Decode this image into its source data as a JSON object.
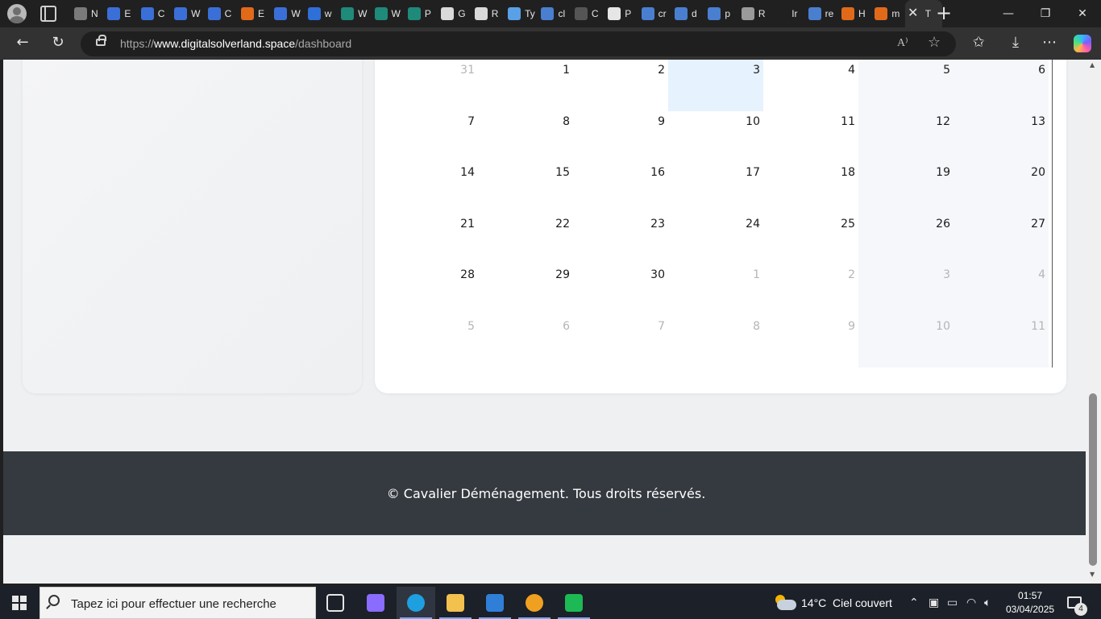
{
  "browser": {
    "tabs": [
      {
        "title": "N",
        "icon": "globe-icon"
      },
      {
        "title": "E",
        "icon": "slash-icon"
      },
      {
        "title": "C",
        "icon": "slash-icon"
      },
      {
        "title": "W",
        "icon": "slash-icon"
      },
      {
        "title": "C",
        "icon": "slash-icon"
      },
      {
        "title": "E",
        "icon": "orange-grid-icon"
      },
      {
        "title": "W",
        "icon": "slash-icon"
      },
      {
        "title": "w",
        "icon": "bing-icon"
      },
      {
        "title": "W",
        "icon": "teal-book-icon"
      },
      {
        "title": "W",
        "icon": "teal-book-icon"
      },
      {
        "title": "P",
        "icon": "teal-book-icon"
      },
      {
        "title": "G",
        "icon": "github-icon"
      },
      {
        "title": "R",
        "icon": "github-icon"
      },
      {
        "title": "Ty",
        "icon": "terminal-icon"
      },
      {
        "title": "cl",
        "icon": "search-icon"
      },
      {
        "title": "C",
        "icon": "dark-circle-icon"
      },
      {
        "title": "P",
        "icon": "openai-icon"
      },
      {
        "title": "cr",
        "icon": "search-icon"
      },
      {
        "title": "d",
        "icon": "search-icon"
      },
      {
        "title": "p",
        "icon": "search-icon"
      },
      {
        "title": "R",
        "icon": "image-icon"
      },
      {
        "title": "Ir",
        "icon": "blank-icon"
      },
      {
        "title": "re",
        "icon": "search-icon"
      },
      {
        "title": "H",
        "icon": "orange-grid-icon"
      },
      {
        "title": "m",
        "icon": "orange-grid-icon"
      },
      {
        "title": "T",
        "icon": "blank-icon",
        "active": true
      }
    ],
    "url_prefix": "https://",
    "url_host": "www.digitalsolverland.space",
    "url_path": "/dashboard",
    "read_aloud": "A⁾"
  },
  "calendar": {
    "days": [
      {
        "n": "31",
        "other": true
      },
      {
        "n": "1"
      },
      {
        "n": "2"
      },
      {
        "n": "3",
        "today": true
      },
      {
        "n": "4"
      },
      {
        "n": "5",
        "weekend": true
      },
      {
        "n": "6",
        "weekend": true
      },
      {
        "n": "7"
      },
      {
        "n": "8"
      },
      {
        "n": "9"
      },
      {
        "n": "10"
      },
      {
        "n": "11"
      },
      {
        "n": "12",
        "weekend": true
      },
      {
        "n": "13",
        "weekend": true
      },
      {
        "n": "14"
      },
      {
        "n": "15"
      },
      {
        "n": "16"
      },
      {
        "n": "17"
      },
      {
        "n": "18"
      },
      {
        "n": "19",
        "weekend": true
      },
      {
        "n": "20",
        "weekend": true
      },
      {
        "n": "21"
      },
      {
        "n": "22"
      },
      {
        "n": "23"
      },
      {
        "n": "24"
      },
      {
        "n": "25"
      },
      {
        "n": "26",
        "weekend": true
      },
      {
        "n": "27",
        "weekend": true
      },
      {
        "n": "28"
      },
      {
        "n": "29"
      },
      {
        "n": "30"
      },
      {
        "n": "1",
        "other": true
      },
      {
        "n": "2",
        "other": true
      },
      {
        "n": "3",
        "other": true,
        "weekend": true
      },
      {
        "n": "4",
        "other": true,
        "weekend": true
      },
      {
        "n": "5",
        "other": true
      },
      {
        "n": "6",
        "other": true
      },
      {
        "n": "7",
        "other": true
      },
      {
        "n": "8",
        "other": true
      },
      {
        "n": "9",
        "other": true
      },
      {
        "n": "10",
        "other": true,
        "weekend": true
      },
      {
        "n": "11",
        "other": true,
        "weekend": true
      }
    ]
  },
  "footer": {
    "text": "© Cavalier Déménagement. Tous droits réservés."
  },
  "taskbar": {
    "search_placeholder": "Tapez ici pour effectuer une recherche",
    "apps": [
      {
        "name": "task-view-icon",
        "color": "#1c2028"
      },
      {
        "name": "copilot-app-icon",
        "color": "#8a6cff"
      },
      {
        "name": "edge-icon",
        "color": "#1e9fe0"
      },
      {
        "name": "file-explorer-icon",
        "color": "#f2c14e"
      },
      {
        "name": "mail-icon",
        "color": "#2f7fd8"
      },
      {
        "name": "vpn-app-icon",
        "color": "#f0a020"
      },
      {
        "name": "terminal-app-icon",
        "color": "#1db954"
      }
    ],
    "weather_temp": "14°C",
    "weather_desc": "Ciel couvert",
    "time": "01:57",
    "date": "03/04/2025",
    "notifications": "4"
  },
  "colors": {
    "accent_today": "#e6f2fd",
    "footer_bg": "#353a40",
    "page_bg": "#eef0f2"
  }
}
